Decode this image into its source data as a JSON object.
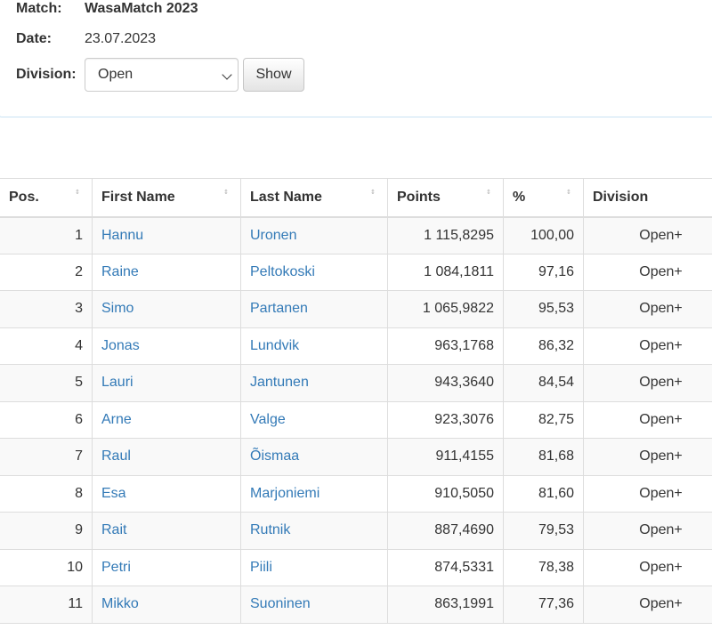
{
  "info": {
    "match_label": "Match:",
    "match_value": "WasaMatch 2023",
    "date_label": "Date:",
    "date_value": "23.07.2023",
    "division_label": "Division:",
    "division_selected": "Open",
    "show_button": "Show"
  },
  "table": {
    "columns": [
      "Pos.",
      "First Name",
      "Last Name",
      "Points",
      "%",
      "Division"
    ],
    "sort_icon": "sort-icon",
    "link_color": "#337ab7",
    "rows": [
      {
        "pos": "1",
        "first": "Hannu",
        "last": "Uronen",
        "points": "1 115,8295",
        "pct": "100,00",
        "division": "Open+"
      },
      {
        "pos": "2",
        "first": "Raine",
        "last": "Peltokoski",
        "points": "1 084,1811",
        "pct": "97,16",
        "division": "Open+"
      },
      {
        "pos": "3",
        "first": "Simo",
        "last": "Partanen",
        "points": "1 065,9822",
        "pct": "95,53",
        "division": "Open+"
      },
      {
        "pos": "4",
        "first": "Jonas",
        "last": "Lundvik",
        "points": "963,1768",
        "pct": "86,32",
        "division": "Open+"
      },
      {
        "pos": "5",
        "first": "Lauri",
        "last": "Jantunen",
        "points": "943,3640",
        "pct": "84,54",
        "division": "Open+"
      },
      {
        "pos": "6",
        "first": "Arne",
        "last": "Valge",
        "points": "923,3076",
        "pct": "82,75",
        "division": "Open+"
      },
      {
        "pos": "7",
        "first": "Raul",
        "last": "Õismaa",
        "points": "911,4155",
        "pct": "81,68",
        "division": "Open+"
      },
      {
        "pos": "8",
        "first": "Esa",
        "last": "Marjoniemi",
        "points": "910,5050",
        "pct": "81,60",
        "division": "Open+"
      },
      {
        "pos": "9",
        "first": "Rait",
        "last": "Rutnik",
        "points": "887,4690",
        "pct": "79,53",
        "division": "Open+"
      },
      {
        "pos": "10",
        "first": "Petri",
        "last": "Piili",
        "points": "874,5331",
        "pct": "78,38",
        "division": "Open+"
      },
      {
        "pos": "11",
        "first": "Mikko",
        "last": "Suoninen",
        "points": "863,1991",
        "pct": "77,36",
        "division": "Open+"
      }
    ]
  }
}
